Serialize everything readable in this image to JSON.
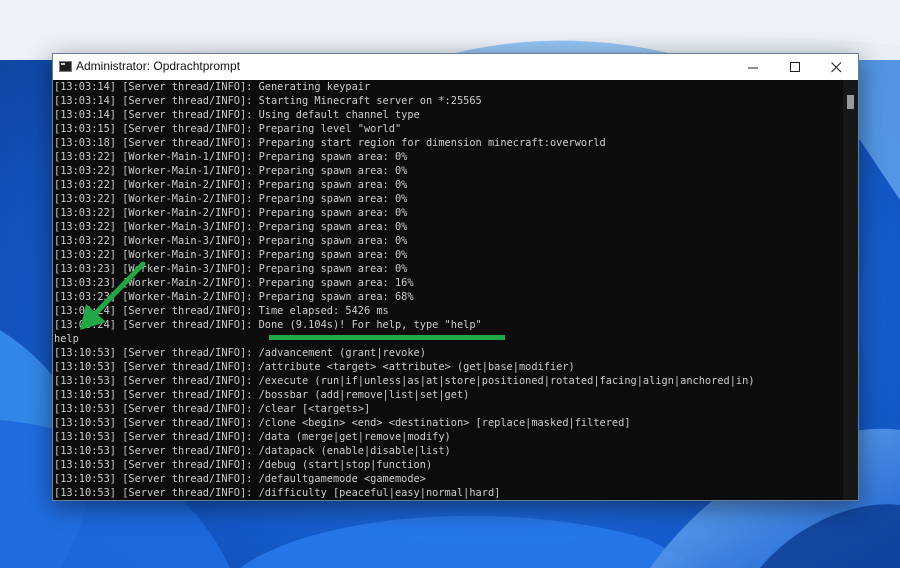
{
  "window": {
    "title": "Administrator: Opdrachtprompt",
    "icon": "cmd-icon",
    "controls": [
      "minimize-icon",
      "maximize-icon",
      "close-icon"
    ]
  },
  "console": {
    "lines": [
      "[13:03:14] [Server thread/INFO]: Generating keypair",
      "[13:03:14] [Server thread/INFO]: Starting Minecraft server on *:25565",
      "[13:03:14] [Server thread/INFO]: Using default channel type",
      "[13:03:15] [Server thread/INFO]: Preparing level \"world\"",
      "[13:03:18] [Server thread/INFO]: Preparing start region for dimension minecraft:overworld",
      "[13:03:22] [Worker-Main-1/INFO]: Preparing spawn area: 0%",
      "[13:03:22] [Worker-Main-1/INFO]: Preparing spawn area: 0%",
      "[13:03:22] [Worker-Main-2/INFO]: Preparing spawn area: 0%",
      "[13:03:22] [Worker-Main-2/INFO]: Preparing spawn area: 0%",
      "[13:03:22] [Worker-Main-2/INFO]: Preparing spawn area: 0%",
      "[13:03:22] [Worker-Main-3/INFO]: Preparing spawn area: 0%",
      "[13:03:22] [Worker-Main-3/INFO]: Preparing spawn area: 0%",
      "[13:03:22] [Worker-Main-3/INFO]: Preparing spawn area: 0%",
      "[13:03:23] [Worker-Main-3/INFO]: Preparing spawn area: 0%",
      "[13:03:23] [Worker-Main-2/INFO]: Preparing spawn area: 16%",
      "[13:03:23] [Worker-Main-2/INFO]: Preparing spawn area: 68%",
      "[13:03:24] [Server thread/INFO]: Time elapsed: 5426 ms",
      "[13:03:24] [Server thread/INFO]: Done (9.104s)! For help, type \"help\"",
      "help",
      "[13:10:53] [Server thread/INFO]: /advancement (grant|revoke)",
      "[13:10:53] [Server thread/INFO]: /attribute <target> <attribute> (get|base|modifier)",
      "[13:10:53] [Server thread/INFO]: /execute (run|if|unless|as|at|store|positioned|rotated|facing|align|anchored|in)",
      "[13:10:53] [Server thread/INFO]: /bossbar (add|remove|list|set|get)",
      "[13:10:53] [Server thread/INFO]: /clear [<targets>]",
      "[13:10:53] [Server thread/INFO]: /clone <begin> <end> <destination> [replace|masked|filtered]",
      "[13:10:53] [Server thread/INFO]: /data (merge|get|remove|modify)",
      "[13:10:53] [Server thread/INFO]: /datapack (enable|disable|list)",
      "[13:10:53] [Server thread/INFO]: /debug (start|stop|function)",
      "[13:10:53] [Server thread/INFO]: /defaultgamemode <gamemode>",
      "[13:10:53] [Server thread/INFO]: /difficulty [peaceful|easy|normal|hard]"
    ]
  },
  "annotations": {
    "arrow_icon": "green-arrow-icon",
    "highlight_color": "#1fa845"
  }
}
